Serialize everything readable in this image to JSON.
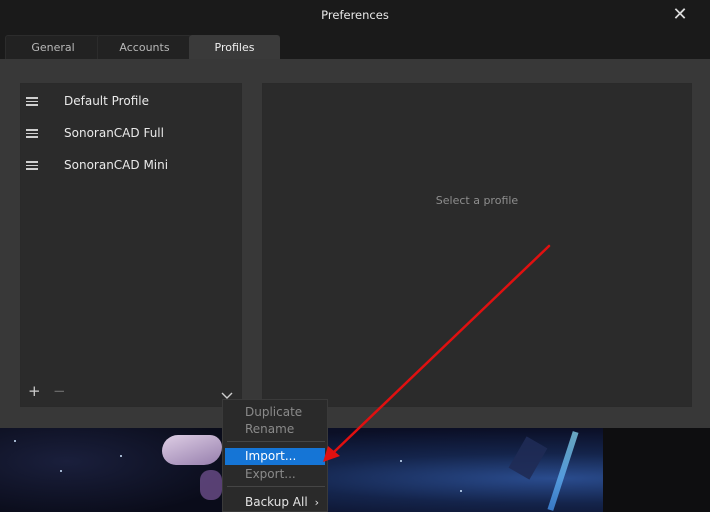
{
  "window": {
    "title": "Preferences",
    "close_icon": "close-icon"
  },
  "tabs": [
    {
      "label": "General",
      "active": false
    },
    {
      "label": "Accounts",
      "active": false
    },
    {
      "label": "Profiles",
      "active": true
    }
  ],
  "profiles": {
    "items": [
      {
        "label": "Default Profile",
        "icon": "drag-handle-icon"
      },
      {
        "label": "SonoranCAD Full",
        "icon": "drag-handle-icon"
      },
      {
        "label": "SonoranCAD Mini",
        "icon": "drag-handle-icon"
      }
    ],
    "add_label": "+",
    "remove_label": "−",
    "more_icon": "chevron-down-icon"
  },
  "detail": {
    "placeholder": "Select a profile"
  },
  "context_menu": {
    "items": [
      {
        "label": "Duplicate",
        "enabled": false
      },
      {
        "label": "Rename",
        "enabled": false
      },
      {
        "label": "Import...",
        "enabled": true,
        "selected": true
      },
      {
        "label": "Export...",
        "enabled": false
      },
      {
        "label": "Backup All",
        "enabled": true,
        "has_submenu": true,
        "arrow": "›"
      }
    ]
  },
  "annotation": {
    "type": "arrow",
    "color": "#e01010",
    "points_to": "Import..."
  },
  "colors": {
    "accent": "#1575d6",
    "dialog_bg": "#383838",
    "panel_bg": "#2b2b2b"
  }
}
